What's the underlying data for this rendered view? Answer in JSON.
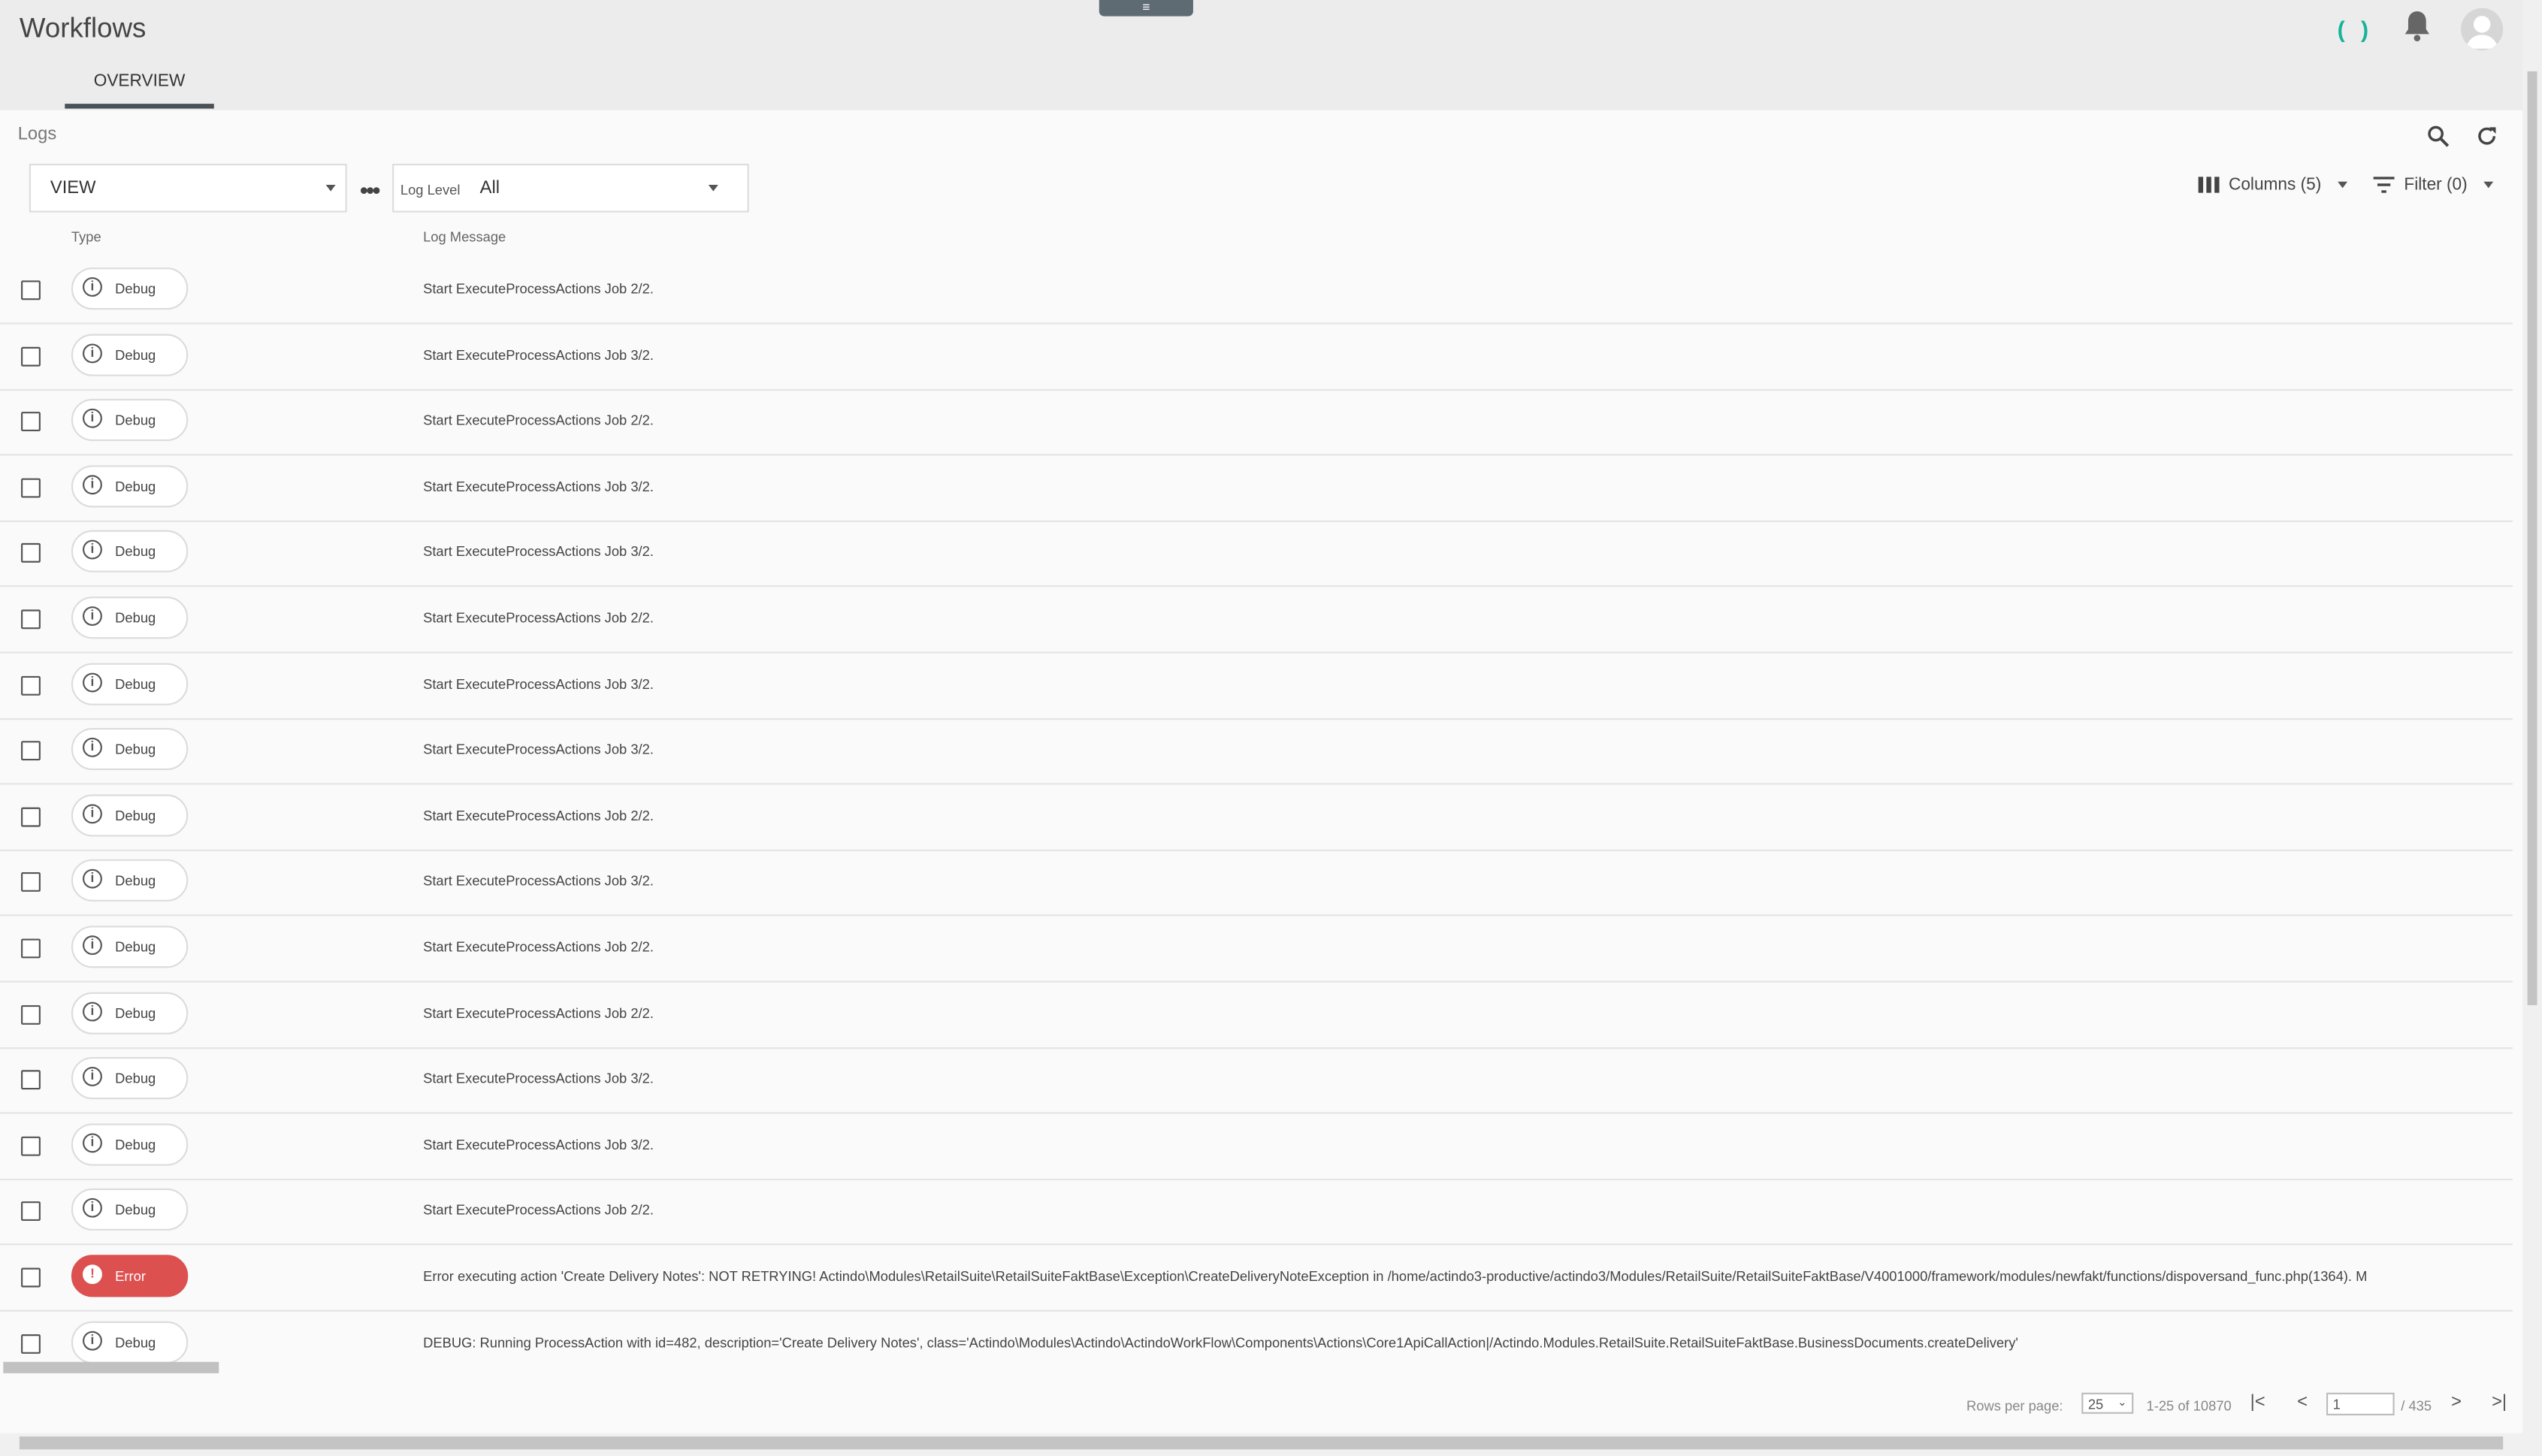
{
  "header": {
    "title": "Workflows",
    "handle_icon": "≡",
    "tabs": [
      {
        "label": "OVERVIEW"
      }
    ],
    "sync_icon": "( )"
  },
  "panel": {
    "title": "Logs",
    "view_select": {
      "value": "VIEW"
    },
    "more_icon": "•••",
    "log_level": {
      "label": "Log Level",
      "value": "All"
    },
    "columns_label": "Columns (5)",
    "filter_label": "Filter (0)"
  },
  "table": {
    "headers": {
      "type": "Type",
      "message": "Log Message"
    },
    "rows": [
      {
        "type": "Debug",
        "message": "Start ExecuteProcessActions Job 2/2."
      },
      {
        "type": "Debug",
        "message": "Start ExecuteProcessActions Job 3/2."
      },
      {
        "type": "Debug",
        "message": "Start ExecuteProcessActions Job 2/2."
      },
      {
        "type": "Debug",
        "message": "Start ExecuteProcessActions Job 3/2."
      },
      {
        "type": "Debug",
        "message": "Start ExecuteProcessActions Job 3/2."
      },
      {
        "type": "Debug",
        "message": "Start ExecuteProcessActions Job 2/2."
      },
      {
        "type": "Debug",
        "message": "Start ExecuteProcessActions Job 3/2."
      },
      {
        "type": "Debug",
        "message": "Start ExecuteProcessActions Job 3/2."
      },
      {
        "type": "Debug",
        "message": "Start ExecuteProcessActions Job 2/2."
      },
      {
        "type": "Debug",
        "message": "Start ExecuteProcessActions Job 3/2."
      },
      {
        "type": "Debug",
        "message": "Start ExecuteProcessActions Job 2/2."
      },
      {
        "type": "Debug",
        "message": "Start ExecuteProcessActions Job 2/2."
      },
      {
        "type": "Debug",
        "message": "Start ExecuteProcessActions Job 3/2."
      },
      {
        "type": "Debug",
        "message": "Start ExecuteProcessActions Job 3/2."
      },
      {
        "type": "Debug",
        "message": "Start ExecuteProcessActions Job 2/2."
      },
      {
        "type": "Error",
        "message": "Error executing action 'Create Delivery Notes': NOT RETRYING! Actindo\\Modules\\RetailSuite\\RetailSuiteFaktBase\\Exception\\CreateDeliveryNoteException in /home/actindo3-productive/actindo3/Modules/RetailSuite/RetailSuiteFaktBase/V4001000/framework/modules/newfakt/functions/dispoversand_func.php(1364). M"
      },
      {
        "type": "Debug",
        "message": "DEBUG: Running ProcessAction with id=482, description='Create Delivery Notes', class='Actindo\\Modules\\Actindo\\ActindoWorkFlow\\Components\\Actions\\Core1ApiCallAction|/Actindo.Modules.RetailSuite.RetailSuiteFaktBase.BusinessDocuments.createDelivery'"
      }
    ]
  },
  "pagination": {
    "rows_per_page_label": "Rows per page:",
    "rows_per_page": "25",
    "range": "1-25 of 10870",
    "page": "1",
    "total_pages": "/ 435",
    "first_icon": "|<",
    "prev_icon": "<",
    "next_icon": ">",
    "last_icon": ">|"
  },
  "colors": {
    "accent": "#17b39a",
    "error": "#dc5050",
    "tab_underline": "#4a5257"
  }
}
